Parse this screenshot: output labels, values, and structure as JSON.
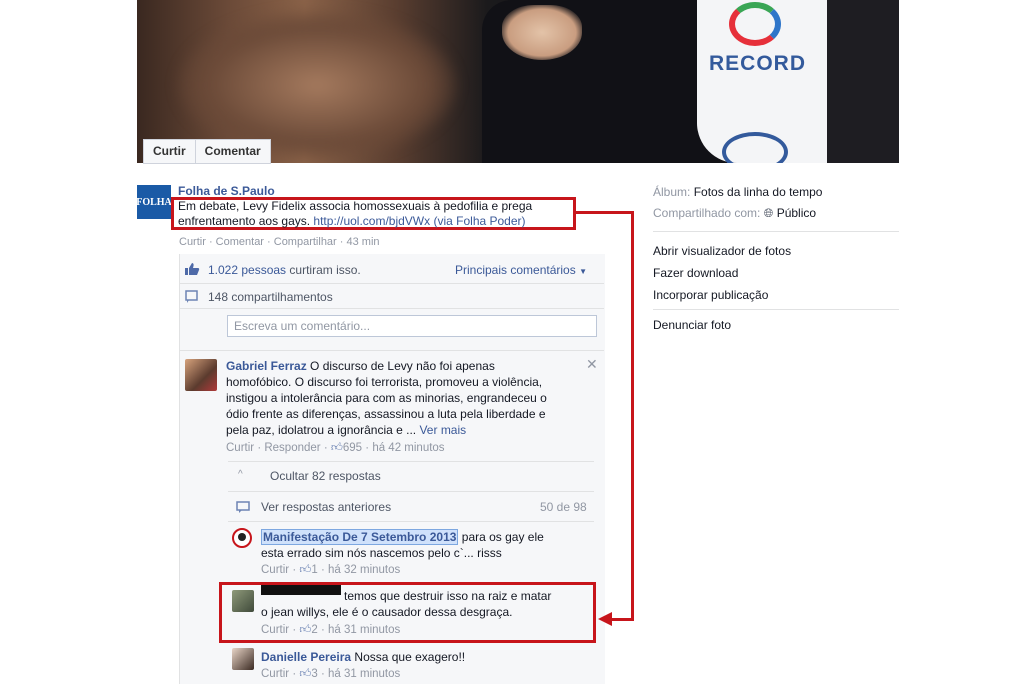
{
  "photo": {
    "watermark": "RECORD",
    "actions": [
      "Curtir",
      "Comentar"
    ]
  },
  "post": {
    "avatar_text": "FOLHA",
    "author": "Folha de S.Paulo",
    "text_line1": "Em debate, Levy Fidelix associa homossexuais à pedofilia e prega",
    "text_line2_pre": "enfrentamento aos gays. ",
    "link": "http://uol.com/bjdVWx",
    "via": " (via Folha Poder)",
    "actions": {
      "like": "Curtir",
      "comment": "Comentar",
      "share": "Compartilhar",
      "time": "43 min"
    }
  },
  "stats": {
    "likes_count": "1.022 pessoas",
    "likes_suffix": "curtiram isso.",
    "sort_label": "Principais comentários",
    "shares": "148 compartilhamentos",
    "comment_placeholder": "Escreva um comentário..."
  },
  "comments": [
    {
      "author": "Gabriel Ferraz",
      "lines": [
        "O discurso de Levy não foi apenas",
        "homofóbico. O discurso foi terrorista, promoveu a violência,",
        "instigou a intolerância para com as minorias, engrandeceu o",
        "ódio frente as diferenças, assassinou a luta pela liberdade e",
        "pela paz, idolatrou a ignorância e ..."
      ],
      "see_more": "Ver mais",
      "like": "Curtir",
      "reply": "Responder",
      "likes": "695",
      "time": "há 42 minutos"
    }
  ],
  "replies_section": {
    "hide": "Ocultar 82 respostas",
    "previous": "Ver respostas anteriores",
    "count": "50 de 98"
  },
  "replies": [
    {
      "author": "Manifestação De 7 Setembro 2013",
      "line1": "para os gay ele",
      "line2": "esta errado sim nós nascemos pelo c`... risss",
      "like": "Curtir",
      "likes": "1",
      "time": "há 32 minutos"
    },
    {
      "author": "",
      "line1": "temos que destruir isso na raiz e matar",
      "line2": "o jean willys, ele é o causador dessa desgraça.",
      "like": "Curtir",
      "likes": "2",
      "time": "há 31 minutos"
    },
    {
      "author": "Danielle Pereira",
      "line1": "Nossa que exagero!!",
      "like": "Curtir",
      "likes": "3",
      "time": "há 31 minutos"
    }
  ],
  "sidebar": {
    "album_label": "Álbum:",
    "album_value": "Fotos da linha do tempo",
    "shared_label": "Compartilhado com:",
    "shared_value": "Público",
    "links": [
      "Abrir visualizador de fotos",
      "Fazer download",
      "Incorporar publicação"
    ],
    "report": "Denunciar foto"
  },
  "colors": {
    "annotation_red": "#c7151b",
    "link_blue": "#3b5998"
  }
}
